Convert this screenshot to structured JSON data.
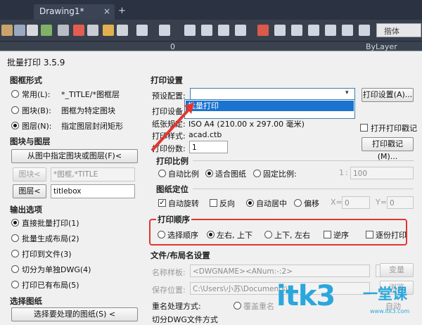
{
  "cad": {
    "tab_title": "Drawing1*",
    "tab_close": "×",
    "tab_add": "+",
    "font_box": "揩体",
    "layer_text": "ByLayer",
    "layer_num": "0"
  },
  "dialog": {
    "title": "批量打印 3.5.9",
    "frame_style": {
      "group": "图框形式",
      "options": [
        {
          "label": "常用(L):",
          "value": "*_TITLE/*图框层",
          "selected": false
        },
        {
          "label": "图块(B):",
          "value": "图框为特定图块",
          "selected": false
        },
        {
          "label": "图层(N):",
          "value": "指定图层封闭矩形",
          "selected": true
        }
      ]
    },
    "block_layer": {
      "group": "图块与图层",
      "from_drawing_button": "从图中指定图块或图层(F)<",
      "block_button": "图块<",
      "block_value": "*图框,*TITLE",
      "layer_button": "图层<",
      "layer_value": "titlebox"
    },
    "output": {
      "group": "输出选项",
      "options": [
        {
          "label": "直接批量打印(1)",
          "selected": true
        },
        {
          "label": "批量生成布局(2)",
          "selected": false
        },
        {
          "label": "打印到文件(3)",
          "selected": false
        },
        {
          "label": "切分为单独DWG(4)",
          "selected": false
        },
        {
          "label": "打印已有布局(5)",
          "selected": false
        }
      ]
    },
    "select": {
      "group": "选择图纸",
      "button": "选择要处理的图纸(S) <"
    },
    "print_settings": {
      "group": "打印设置",
      "preset_label": "预设配置:",
      "preset_value": "",
      "preset_option": "批量打印",
      "print_setup_button": "打印设置(A)...",
      "device_label": "打印设备",
      "paper_label": "纸张规定:",
      "paper_value": "ISO A4 (210.00 x 297.00 毫米)",
      "style_label": "打印样式:",
      "style_value": "acad.ctb",
      "stamp_check": "打开打印戳记",
      "copies_label": "打印份数:",
      "copies_value": "1",
      "stamp_button": "打印戳记(M)..."
    },
    "scale": {
      "group": "打印比例",
      "options": [
        {
          "label": "自动比例",
          "selected": false
        },
        {
          "label": "适合图纸",
          "selected": true
        },
        {
          "label": "固定比例:",
          "selected": false
        }
      ],
      "ratio_left": "1",
      "ratio_sep": ":",
      "ratio_right": "100"
    },
    "position": {
      "group": "图纸定位",
      "auto_rotate": "自动旋转",
      "auto_rotate_checked": true,
      "reverse": "反向",
      "reverse_checked": false,
      "center": "自动居中",
      "center_selected": true,
      "offset": "偏移",
      "offset_selected": false,
      "x_label": "X=",
      "x_value": "0",
      "y_label": "Y=",
      "y_value": "0"
    },
    "order": {
      "group": "打印顺序",
      "options": [
        {
          "label": "选择顺序",
          "selected": false
        },
        {
          "label": "左右, 上下",
          "selected": true
        },
        {
          "label": "上下, 左右",
          "selected": false
        }
      ],
      "reverse": "逆序",
      "reverse_copies": "逐份打印"
    },
    "file_naming": {
      "group": "文件/布局名设置",
      "name_label": "名称样板:",
      "name_value": "<DWGNAME><ANum:-:2>",
      "change_button": "变量",
      "save_label": "保存位置:",
      "save_value": "C:\\Users\\小苏\\Documents\\",
      "browse_button": "浏览",
      "rename_label": "重名处理方式:",
      "overwrite": "覆盖重名",
      "split_label": "切分DWG文件方式",
      "auto_label": "自动"
    }
  },
  "watermark": {
    "text": "itk3",
    "cn": "一堂课",
    "url": "www.itk3.com"
  },
  "colors": {
    "highlight_box": "#e3352f",
    "selection": "#1a73cf",
    "watermark": "#2aa7dc"
  }
}
